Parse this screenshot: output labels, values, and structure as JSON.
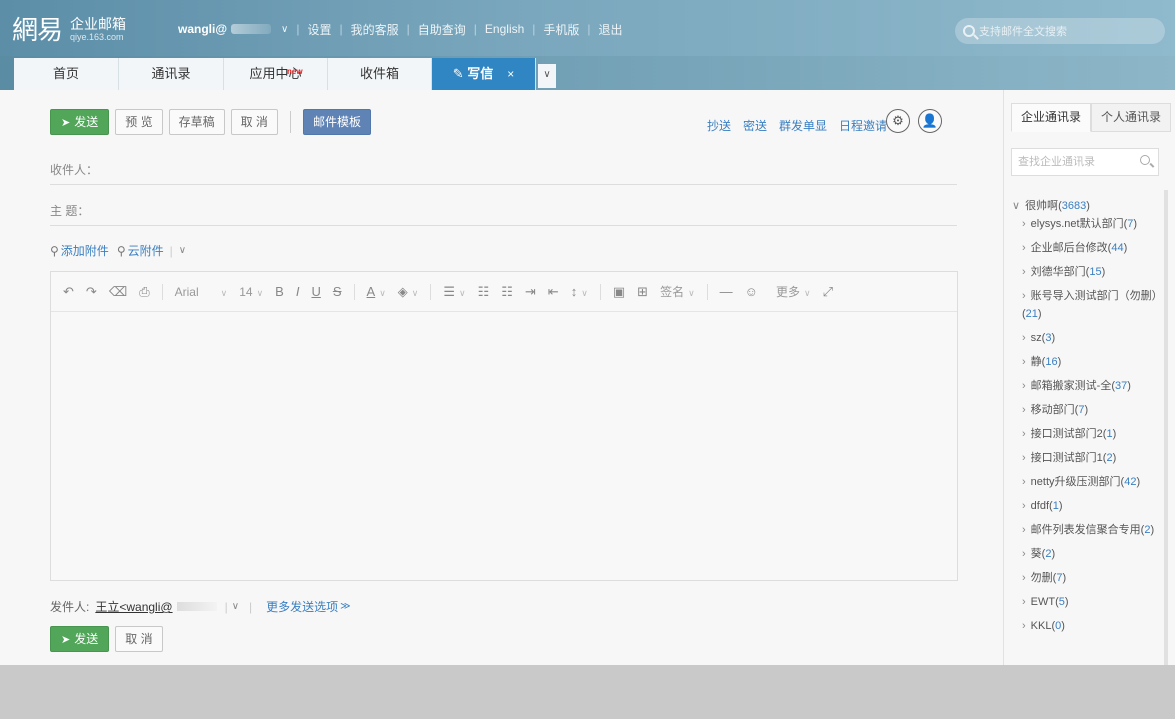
{
  "header": {
    "logo_char": "網易",
    "logo_name": "企业邮箱",
    "logo_sub": "qiye.163.com",
    "user": "wangli@",
    "nav": [
      "设置",
      "我的客服",
      "自助查询",
      "English",
      "手机版",
      "退出"
    ],
    "search_placeholder": "支持邮件全文搜索"
  },
  "tabs": [
    {
      "label": "首页"
    },
    {
      "label": "通讯录"
    },
    {
      "label": "应用中心",
      "badge": "new"
    },
    {
      "label": "收件箱"
    },
    {
      "label": "写信",
      "close": "×"
    }
  ],
  "toolbar": {
    "send": "发送",
    "preview": "预 览",
    "draft": "存草稿",
    "cancel": "取 消",
    "template": "邮件模板",
    "links": [
      "抄送",
      "密送",
      "群发单显",
      "日程邀请"
    ]
  },
  "form": {
    "to_label": "收件人：",
    "subject_label": "主  题：",
    "attach": "添加附件",
    "cloud_attach": "云附件"
  },
  "editor": {
    "font": "Arial",
    "size": "14",
    "signature": "签名",
    "more": "更多"
  },
  "sender": {
    "label": "发件人:",
    "name": "王立<wangli@",
    "more_options": "更多发送选项"
  },
  "bottom": {
    "send": "发送",
    "cancel": "取 消"
  },
  "panel": {
    "tab_enterprise": "企业通讯录",
    "tab_personal": "个人通讯录",
    "search_placeholder": "查找企业通讯录",
    "root": {
      "name": "很帅啊",
      "count": "3683"
    },
    "departments": [
      {
        "name": "elysys.net默认部门",
        "count": "7"
      },
      {
        "name": "企业邮后台修改",
        "count": "44"
      },
      {
        "name": "刘德华部门",
        "count": "15"
      },
      {
        "name": "账号导入测试部门（勿删）",
        "count": "21"
      },
      {
        "name": "sz",
        "count": "3"
      },
      {
        "name": "静",
        "count": "16"
      },
      {
        "name": "邮箱搬家测试-全",
        "count": "37"
      },
      {
        "name": "移动部门",
        "count": "7"
      },
      {
        "name": "接口测试部门2",
        "count": "1"
      },
      {
        "name": "接口测试部门1",
        "count": "2"
      },
      {
        "name": "netty升级压测部门",
        "count": "42"
      },
      {
        "name": "dfdf",
        "count": "1"
      },
      {
        "name": "邮件列表发信聚合专用",
        "count": "2"
      },
      {
        "name": "葵",
        "count": "2"
      },
      {
        "name": "勿删",
        "count": "7"
      },
      {
        "name": "EWT",
        "count": "5"
      },
      {
        "name": "KKL",
        "count": "0"
      }
    ]
  },
  "colors": {
    "accent": "#2f86c3",
    "send_green": "#52a65a",
    "header": "#6f9fb6",
    "link": "#3a7fc1"
  }
}
